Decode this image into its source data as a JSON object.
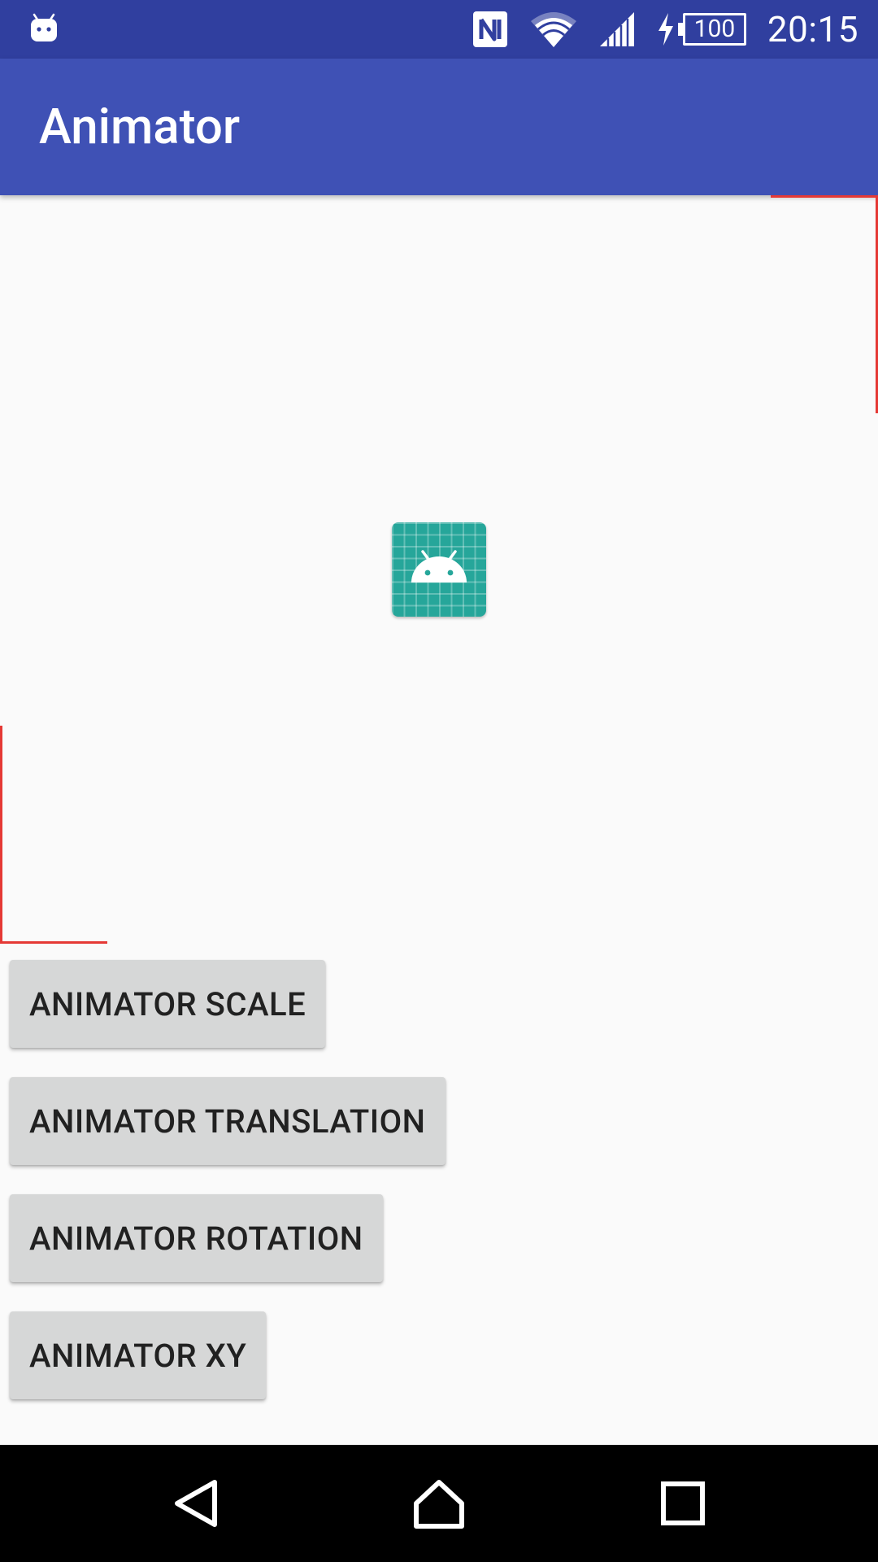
{
  "status_bar": {
    "time": "20:15",
    "battery_level": "100",
    "icons": [
      "android-notification-icon",
      "nfc-icon",
      "wifi-icon",
      "signal-icon",
      "charging-icon",
      "battery-icon"
    ]
  },
  "app_bar": {
    "title": "Animator"
  },
  "main": {
    "image_icon": "android-launcher-icon",
    "buttons": [
      {
        "label": "ANIMATOR SCALE"
      },
      {
        "label": "ANIMATOR TRANSLATION"
      },
      {
        "label": "ANIMATOR ROTATION"
      },
      {
        "label": "ANIMATOR XY"
      }
    ]
  },
  "nav_bar": {
    "icons": [
      "back-icon",
      "home-icon",
      "recents-icon"
    ]
  },
  "colors": {
    "status_bar": "#303f9f",
    "app_bar": "#3f51b5",
    "background": "#fafafa",
    "button": "#d6d7d7",
    "corner_lines": "#e53935",
    "icon_teal": "#26a69a"
  }
}
